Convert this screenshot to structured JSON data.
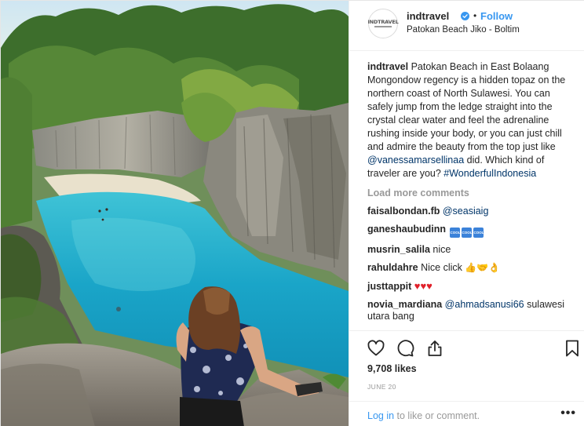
{
  "photo": {
    "icon": "beach-photo"
  },
  "header": {
    "avatar_text": "INDTRAVEL",
    "username": "indtravel",
    "dot": "•",
    "follow_label": "Follow",
    "location": "Patokan Beach Jiko - Boltim"
  },
  "caption": {
    "username": "indtravel",
    "text_1": "Patokan Beach in East Bolaang Mongondow regency is a hidden topaz on the northern coast of North Sulawesi. You can safely jump from the ledge straight into the crystal clear water and feel the adrenaline rushing inside your body, or you can just chill and admire the beauty from the top just like ",
    "mention": "@vanessamarsellinaa",
    "text_2": " did. Which kind of traveler are you? ",
    "hashtag": "#WonderfulIndonesia"
  },
  "load_more": "Load more comments",
  "comments": [
    {
      "username": "faisalbondan.fb",
      "mention": "@seasiaig",
      "text": ""
    },
    {
      "username": "ganeshaubudinn",
      "emojis": [
        "COOL",
        "COOL",
        "COOL"
      ]
    },
    {
      "username": "musrin_salila",
      "text": "nice"
    },
    {
      "username": "rahuldahre",
      "text": "Nice click",
      "emojis": [
        "👍",
        "🤝",
        "👌"
      ]
    },
    {
      "username": "justtappit",
      "emojis": [
        "♥",
        "♥",
        "♥"
      ]
    },
    {
      "username": "novia_mardiana",
      "mention": "@ahmadsanusi66",
      "text": " sulawesi utara bang"
    }
  ],
  "actions": {
    "like_icon": "heart-icon",
    "comment_icon": "comment-icon",
    "share_icon": "share-icon",
    "save_icon": "bookmark-icon",
    "likes": "9,708 likes",
    "date": "JUNE 20"
  },
  "footer": {
    "login_link": "Log in",
    "login_text": " to like or comment.",
    "more_label": "•••"
  },
  "colors": {
    "link": "#3897f0",
    "mention": "#003569",
    "muted": "#999999",
    "heart": "#e0202a"
  }
}
